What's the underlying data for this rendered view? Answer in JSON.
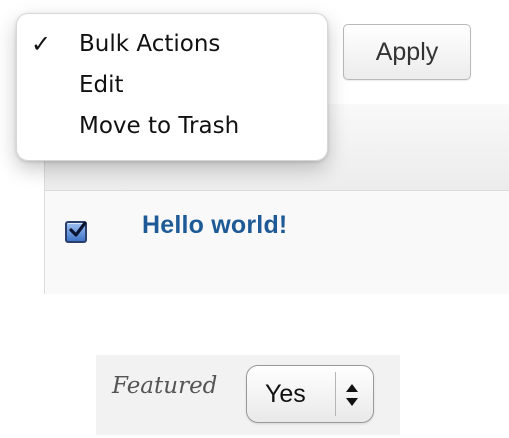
{
  "bulk_actions_menu": {
    "items": [
      {
        "label": "Bulk Actions",
        "checked": true
      },
      {
        "label": "Edit",
        "checked": false
      },
      {
        "label": "Move to Trash",
        "checked": false
      }
    ],
    "check_glyph": "✓"
  },
  "apply_button": {
    "label": "Apply"
  },
  "posts_table": {
    "rows": [
      {
        "title": "Hello world!",
        "checked": true
      }
    ]
  },
  "featured_field": {
    "label": "Featured",
    "selected_value": "Yes"
  },
  "icons": {
    "row_checkbox": "checkbox-checked-icon",
    "select_arrows": "up-down-arrows-icon"
  },
  "colors": {
    "link": "#1e5a96",
    "checkbox_fill": "#3f74c8"
  }
}
